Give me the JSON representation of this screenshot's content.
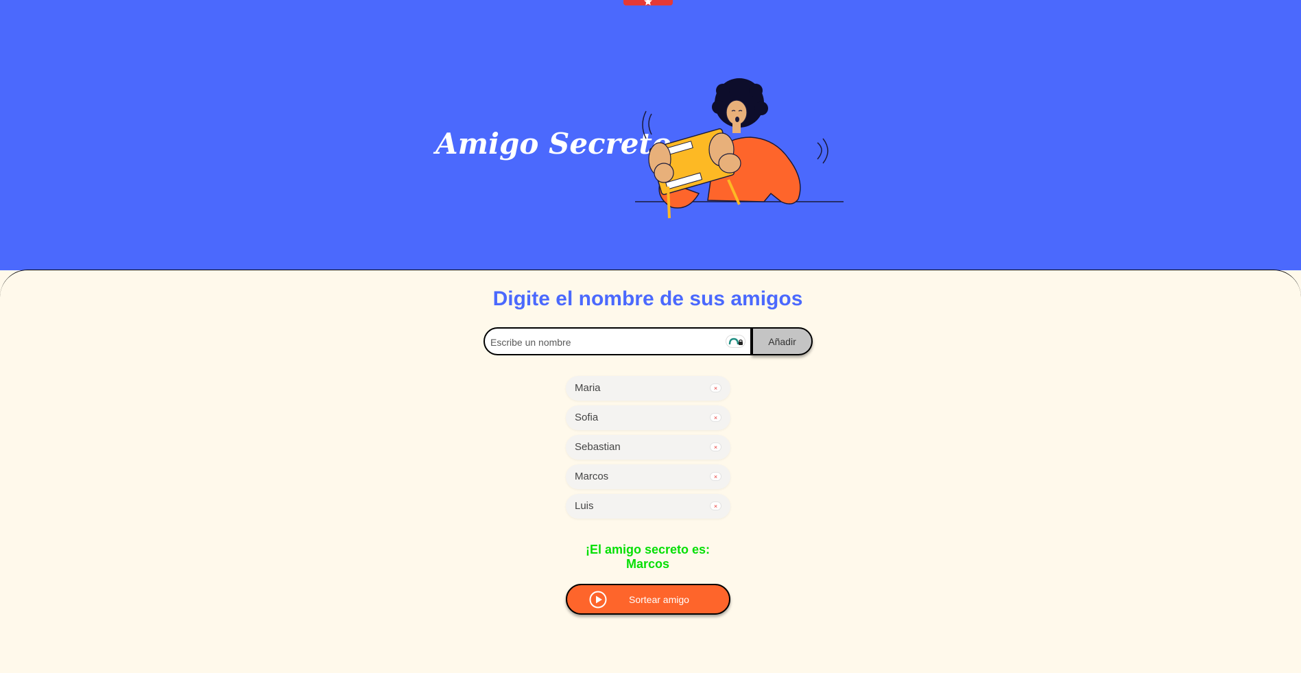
{
  "colors": {
    "header_bg": "#4B69FD",
    "page_bg": "#FFF9EB",
    "accent_orange": "#FE652B",
    "result_green": "#05DF05",
    "button_gray": "#C4C4C4"
  },
  "header": {
    "title": "Amigo Secreto",
    "illustration": "person-shaking-gift-box"
  },
  "main": {
    "section_title": "Digite el nombre de sus amigos",
    "name_input": {
      "placeholder": "Escribe un nombre",
      "value": ""
    },
    "add_button_label": "Añadir",
    "friends": [
      {
        "name": "Maria",
        "remove_label": "×"
      },
      {
        "name": "Sofia",
        "remove_label": "×"
      },
      {
        "name": "Sebastian",
        "remove_label": "×"
      },
      {
        "name": "Marcos",
        "remove_label": "×"
      },
      {
        "name": "Luis",
        "remove_label": "×"
      }
    ],
    "result_prefix": "¡El amigo secreto es:",
    "result_name": "Marcos",
    "draw_button_label": "Sortear amigo",
    "draw_button_icon": "play-circle-icon"
  }
}
